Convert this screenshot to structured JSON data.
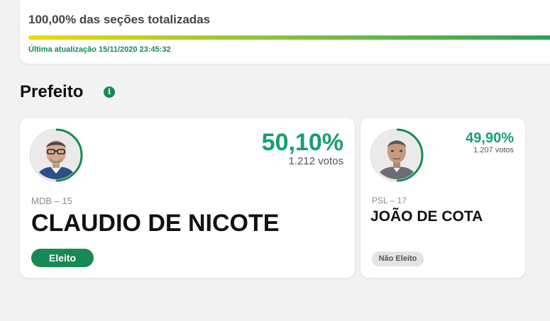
{
  "progress": {
    "title": "100,00% das seções totalizadas",
    "percent": 100,
    "updated": "Última atualização 15/11/2020 23:45:32"
  },
  "section": {
    "title": "Prefeito",
    "info_icon": "info-icon"
  },
  "colors": {
    "accent": "#178a53",
    "percent_green": "#16a06b",
    "bar_start": "#f2d900",
    "bar_end": "#2aa05a"
  },
  "candidates": [
    {
      "party": "MDB – 15",
      "name": "CLAUDIO DE NICOTE",
      "percent": "50,10%",
      "votes": "1.212 votos",
      "status": "Eleito",
      "ring_fraction": 0.501
    },
    {
      "party": "PSL – 17",
      "name": "JOÃO DE COTA",
      "percent": "49,90%",
      "votes": "1.207 votos",
      "status": "Não Eleito",
      "ring_fraction": 0.499
    }
  ]
}
